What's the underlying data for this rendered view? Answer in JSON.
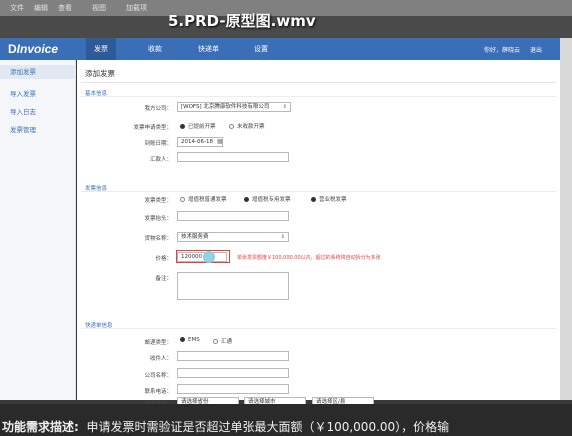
{
  "video": {
    "title": "5.PRD-原型图.wmv",
    "menu": [
      "文件",
      "编辑",
      "查看",
      "视图",
      "加载项"
    ]
  },
  "nav": {
    "logo_mark": "D",
    "logo_text": "Invoice",
    "tabs": [
      "发票",
      "收款",
      "快递单",
      "设置"
    ],
    "user": "你好，薛晓云",
    "logout": "退出"
  },
  "sidebar": {
    "items": [
      "添加发票",
      "导入发票",
      "导入日志",
      "发票管理"
    ]
  },
  "page": {
    "title": "添加发票",
    "sections": {
      "basic": "基本信息",
      "invoice": "发票信息",
      "express": "快递单信息"
    },
    "fields": {
      "company_label": "我方公司：",
      "company_value": "[WOFS] 北京腾康软件科技有限公司",
      "apply_type_label": "发票申请类型：",
      "apply_type_options": [
        "已提前开票",
        "未收款开票"
      ],
      "date_label": "到账日期：",
      "date_value": "2014-06-18",
      "remitter_label": "汇款人：",
      "invoice_type_label": "发票类型：",
      "invoice_type_options": [
        "增值税普通发票",
        "增值税专用发票",
        "营业税发票"
      ],
      "invoice_head_label": "发票抬头：",
      "goods_name_label": "货物名称：",
      "goods_name_value": "技术服务费",
      "price_label": "价格：",
      "price_value": "120000",
      "price_error": "单张发票额度￥100,000.00以内，超过的系统将自动拆分为多张",
      "remark_label": "备注：",
      "courier_label": "邮递类型：",
      "courier_options": [
        "EMS",
        "汇通"
      ],
      "recipient_label": "收件人：",
      "company_name_label": "公司名称：",
      "phone_label": "联系电话：",
      "address_label": "邮递城市：",
      "address_selects": [
        "请选择省份",
        "请选择城市",
        "请选择区/县"
      ]
    }
  },
  "subtitle": {
    "lead": "功能需求描述:",
    "text": "申请发票时需验证是否超过单张最大面额（￥100,000.00），价格输"
  }
}
